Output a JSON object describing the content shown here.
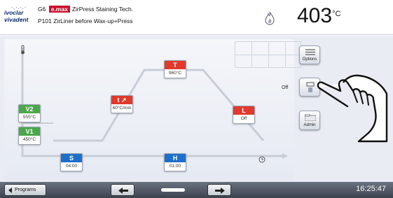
{
  "header": {
    "logo_line1": "ivoclar",
    "logo_line2": "vivadent",
    "furnace_model": "G6",
    "brand_badge": "e.max",
    "program_title": "ZirPress Staining Tech.",
    "program_number": "P101",
    "program_name": "ZirLiner before Wax-up+Press",
    "temperature": "403",
    "temperature_unit": "°C"
  },
  "curve": {
    "thermometer_icon": "thermometer-icon",
    "time_icon": "clock-icon",
    "params": {
      "V2": {
        "label": "V2",
        "value": "555°C"
      },
      "V1": {
        "label": "V1",
        "value": "450°C"
      },
      "S": {
        "label": "S",
        "value": "04:00"
      },
      "t": {
        "label": "t ↗",
        "value": "60°C/min"
      },
      "T": {
        "label": "T",
        "value": "960°C"
      },
      "H": {
        "label": "H",
        "value": "01:00"
      },
      "L": {
        "label": "L",
        "value": "Off"
      }
    }
  },
  "right_panel": {
    "options_label": "Options",
    "off_label": "Off",
    "admin_label": "Admin"
  },
  "footer": {
    "programs_label": "Programs",
    "time": "16:25:47"
  },
  "colors": {
    "red_tag": "#e03a2c",
    "green_tag": "#4aa84a",
    "blue_tag": "#1e6fc9"
  }
}
